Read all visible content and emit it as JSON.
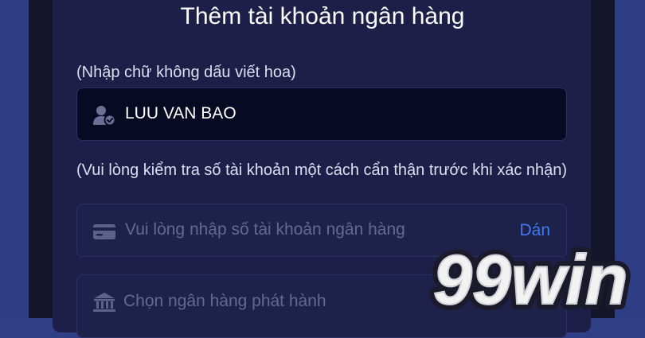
{
  "dialog": {
    "title": "Thêm tài khoản ngân hàng",
    "name_hint": "(Nhập chữ không dấu viết hoa)",
    "name_value": "LUU VAN BAO",
    "account_hint": "(Vui lòng kiểm tra số tài khoản một cách cẩn thận trước khi xác nhận)",
    "account_placeholder": "Vui lòng nhập số tài khoản ngân hàng",
    "paste_label": "Dán",
    "bank_placeholder": "Chọn ngân hàng phát hành"
  },
  "logo": {
    "text": "99win"
  },
  "icons": {
    "name_field": "user-check-icon",
    "account_field": "credit-card-icon",
    "bank_field": "bank-icon"
  },
  "colors": {
    "panel": "#1d1f48",
    "input_dark": "#070a22",
    "accent_link": "#3f7cf4",
    "page_side": "#2f3f86"
  }
}
